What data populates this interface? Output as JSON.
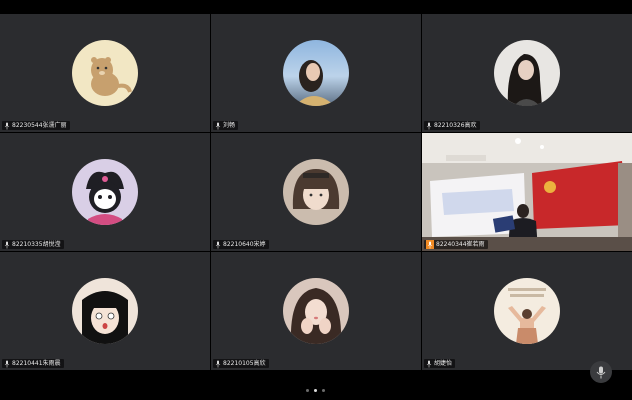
{
  "participants": [
    {
      "name": "82230544张濡广丽",
      "avatar": "cartoon-hamster",
      "muted": true
    },
    {
      "name": "刘畅",
      "avatar": "photo-girl-sky",
      "muted": true
    },
    {
      "name": "82210326高欢",
      "avatar": "photo-girl-longhair",
      "muted": true
    },
    {
      "name": "82210335胡悦滢",
      "avatar": "kuromi-cartoon",
      "muted": true
    },
    {
      "name": "82210640宋婷",
      "avatar": "photo-girl-bangs",
      "muted": true
    },
    {
      "name": "82240344崔若雨",
      "avatar": "live-video-classroom",
      "muted": false,
      "speaking": true
    },
    {
      "name": "82210441朱雨晨",
      "avatar": "anime-girl-blackhair",
      "muted": true
    },
    {
      "name": "82210105高欣",
      "avatar": "photo-girl-hands",
      "muted": true
    },
    {
      "name": "胡婕怡",
      "avatar": "art-person-arms-raised",
      "muted": true
    }
  ],
  "pagination": {
    "pages": 3,
    "current": 2
  },
  "colors": {
    "tile_bg": "#2b2c2f",
    "speaking_accent": "#f08a24"
  }
}
